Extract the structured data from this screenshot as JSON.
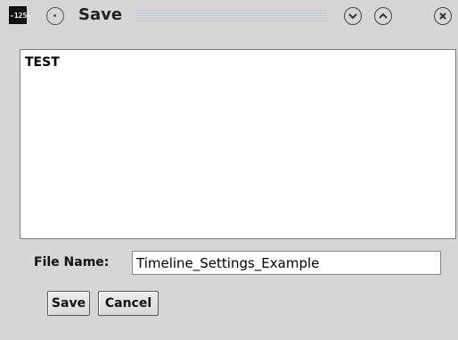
{
  "window": {
    "app_icon_text": "-125-",
    "title": "Save",
    "icons": {
      "app": "app-logo-icon",
      "menu": "window-menu-icon",
      "minimize": "chevron-down-icon",
      "maximize": "chevron-up-icon",
      "close": "close-icon"
    }
  },
  "content": {
    "text": "TEST"
  },
  "form": {
    "file_name_label": "File Name:",
    "file_name_value": "Timeline_Settings_Example"
  },
  "buttons": {
    "save_label": "Save",
    "cancel_label": "Cancel"
  }
}
